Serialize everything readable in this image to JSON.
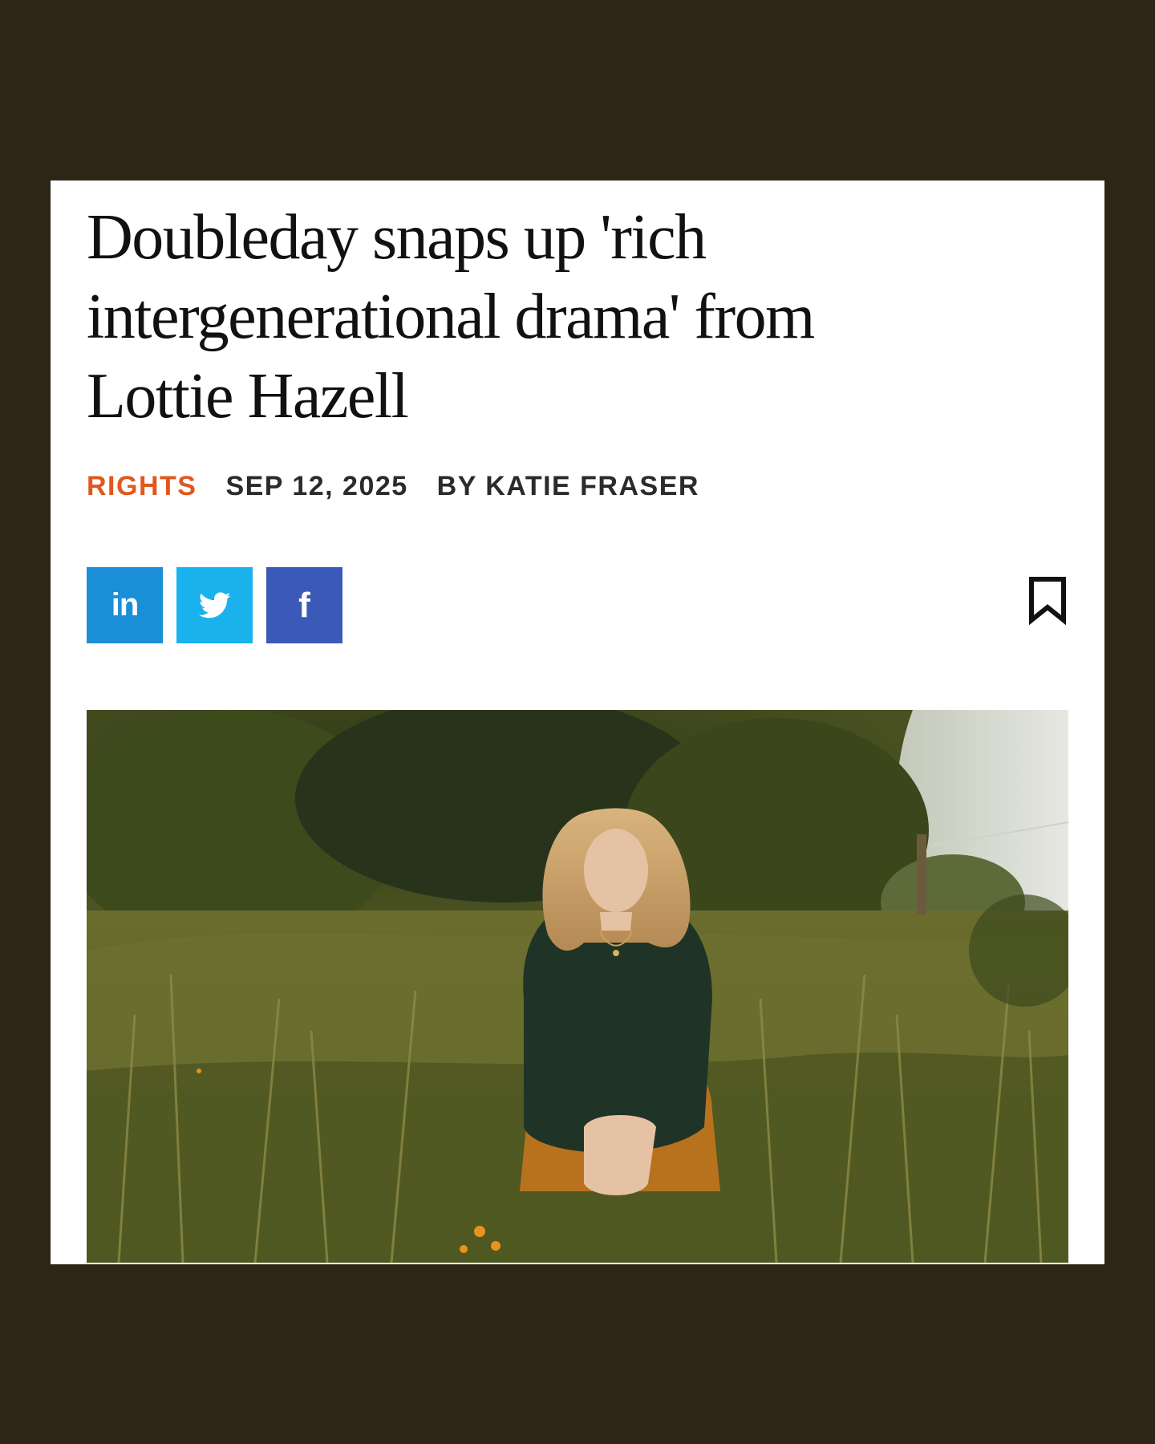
{
  "article": {
    "headline_lines": [
      "Doubleday snaps up 'rich",
      "intergenerational drama' from",
      "Lottie Hazell"
    ],
    "category": "RIGHTS",
    "date": "SEP 12, 2025",
    "byline": "BY KATIE FRASER"
  },
  "share": {
    "linkedin_label": "in",
    "twitter_icon": "twitter-bird-icon",
    "facebook_label": "f"
  },
  "bookmark_icon": "bookmark-icon",
  "photo": {
    "subject": "woman-crouching-in-tall-grass-photo"
  },
  "colors": {
    "page_background": "#2d2616",
    "category": "#e0581e",
    "linkedin": "#1a8fd8",
    "twitter": "#1ab2ec",
    "facebook": "#3b5ab8"
  }
}
